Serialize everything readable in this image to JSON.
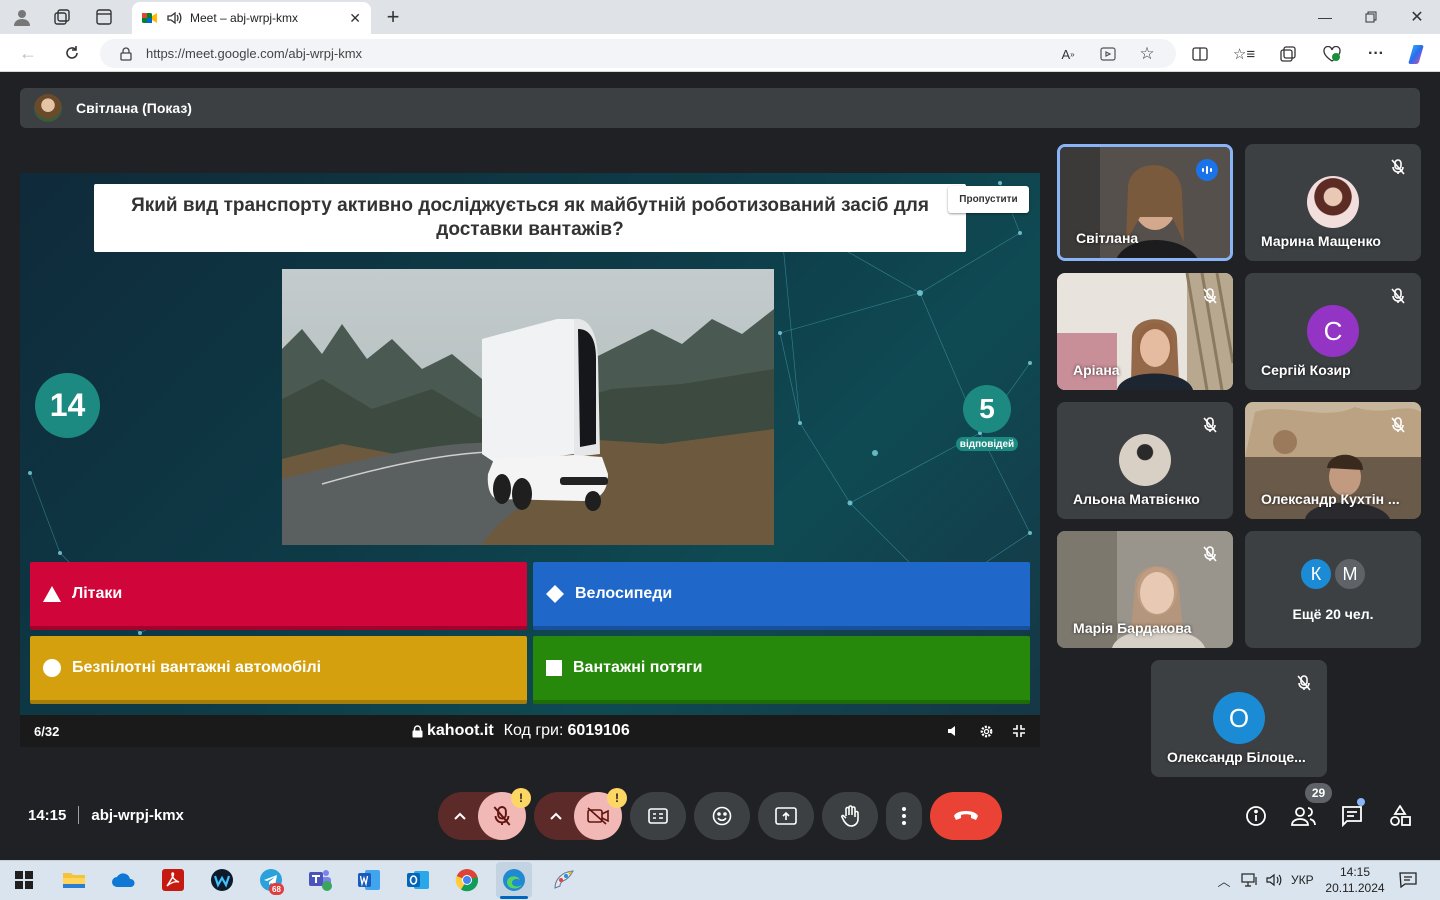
{
  "browser": {
    "tab_title": "Meet – abj-wrpj-kmx",
    "url": "https://meet.google.com/abj-wrpj-kmx"
  },
  "presentation": {
    "presenter_label": "Світлана (Показ)"
  },
  "kahoot": {
    "question": "Який вид транспорту активно досліджується як майбутній роботизований засіб для доставки вантажів?",
    "skip_label": "Пропустити",
    "timer": "14",
    "answers_count": "5",
    "answers_label": "відповідей",
    "options": [
      {
        "label": "Літаки",
        "shape": "triangle",
        "color": "#d0053a"
      },
      {
        "label": "Велосипеди",
        "shape": "diamond",
        "color": "#1f67c9"
      },
      {
        "label": "Безпілотні вантажні автомобілі",
        "shape": "circle",
        "color": "#d4a00e"
      },
      {
        "label": "Вантажні потяги",
        "shape": "square",
        "color": "#26890c"
      }
    ],
    "progress": "6/32",
    "site": "kahoot.it",
    "code_label": "Код гри:",
    "code_value": "6019106"
  },
  "participants": [
    {
      "name": "Світлана",
      "type": "video",
      "speaking": true
    },
    {
      "name": "Марина Мащенко",
      "type": "photo",
      "muted": true
    },
    {
      "name": "Аріана",
      "type": "video",
      "muted": true
    },
    {
      "name": "Сергій Козир",
      "type": "initial",
      "initial": "С",
      "color": "#9334c4",
      "muted": true
    },
    {
      "name": "Альона Матвієнко",
      "type": "photo",
      "muted": true
    },
    {
      "name": "Олександр Кухтін ...",
      "type": "video",
      "muted": true
    },
    {
      "name": "Марія Бардакова",
      "type": "video",
      "muted": true
    },
    {
      "name": "Ещё 20 чел.",
      "type": "more",
      "initials": [
        "К",
        "М"
      ]
    },
    {
      "name": "Олександр Білоце...",
      "type": "initial",
      "initial": "О",
      "color": "#1a8bd4",
      "muted": true
    }
  ],
  "meeting": {
    "time": "14:15",
    "code": "abj-wrpj-kmx",
    "participant_count": "29"
  },
  "taskbar": {
    "telegram_badge": "68",
    "language": "УКР",
    "clock_time": "14:15",
    "clock_date": "20.11.2024"
  }
}
